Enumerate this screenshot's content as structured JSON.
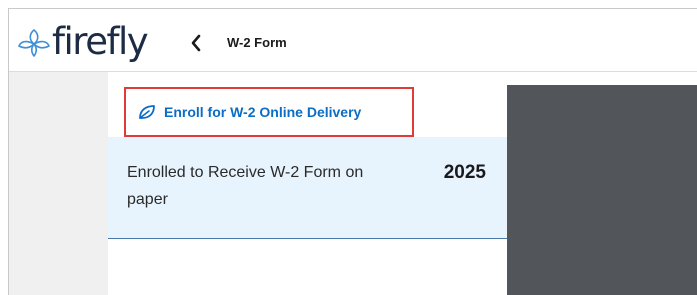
{
  "app": {
    "logo_text": "firefly",
    "logo_icon": "firefly-icon"
  },
  "header": {
    "back_icon": "chevron-left-icon",
    "page_title": "W-2 Form"
  },
  "enroll": {
    "icon": "leaf-icon",
    "label": "Enroll for W-2 Online Delivery"
  },
  "status": {
    "text": "Enrolled to Receive W-2 Form on paper",
    "year": "2025"
  },
  "colors": {
    "link": "#0b6dc6",
    "highlight_border": "#e03b3b",
    "card_background": "#e8f4fd",
    "dark_pane": "#525559",
    "brand_text": "#1d2b44"
  }
}
